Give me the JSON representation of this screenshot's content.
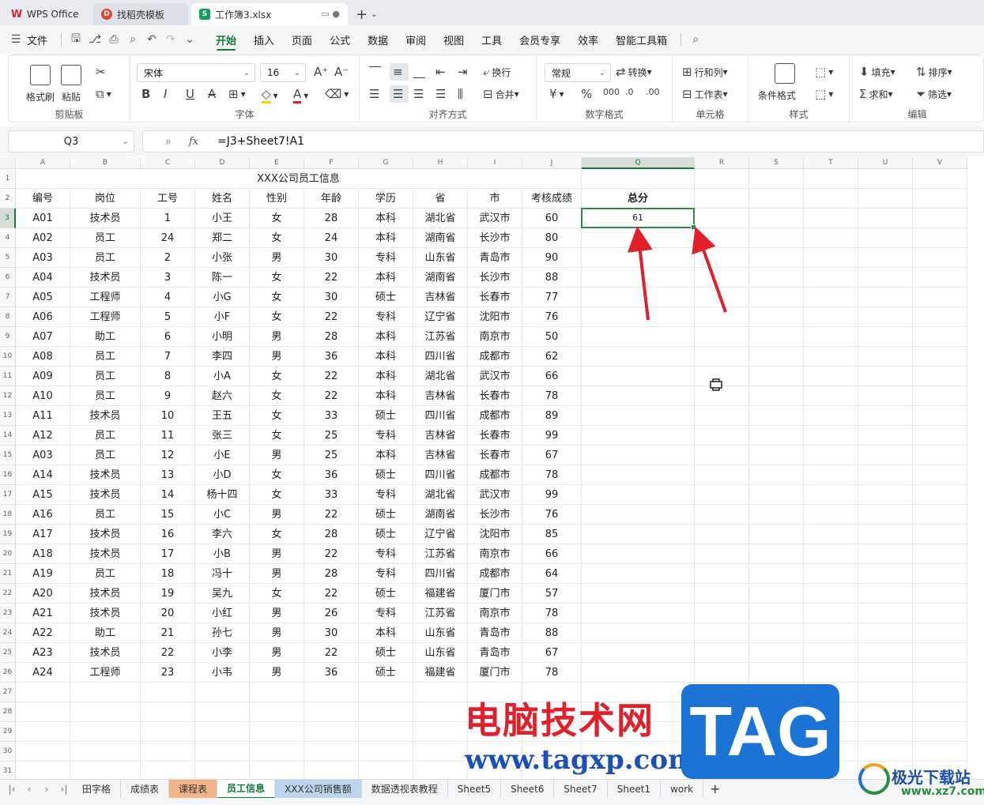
{
  "tabs": [
    {
      "label": "WPS Office",
      "icon": "wps-logo-icon"
    },
    {
      "label": "找稻壳模板",
      "icon": "docer-icon"
    },
    {
      "label": "工作簿3.xlsx",
      "icon": "sheet-icon"
    }
  ],
  "menu": {
    "file": "文件",
    "items": [
      "开始",
      "插入",
      "页面",
      "公式",
      "数据",
      "审阅",
      "视图",
      "工具",
      "会员专享",
      "效率",
      "智能工具箱"
    ],
    "active": "开始"
  },
  "ribbon": {
    "clipboard": {
      "label": "剪贴板",
      "format_painter": "格式刷",
      "paste": "粘贴"
    },
    "font": {
      "label": "字体",
      "name": "宋体",
      "size": "16"
    },
    "align": {
      "label": "对齐方式",
      "wrap": "换行",
      "merge": "合并"
    },
    "number": {
      "label": "数字格式",
      "format": "常规",
      "convert": "转换"
    },
    "cells": {
      "label": "单元格",
      "rowcol": "行和列",
      "worksheet": "工作表"
    },
    "styles": {
      "label": "样式",
      "conditional": "条件格式"
    },
    "editing": {
      "label": "编辑",
      "fill": "填充",
      "sort": "排序",
      "sum": "求和",
      "filter": "筛选"
    }
  },
  "formula_bar": {
    "name_box": "Q3",
    "fx": "fx",
    "formula": "=J3+Sheet7!A1"
  },
  "columns": [
    "A",
    "B",
    "C",
    "D",
    "E",
    "F",
    "G",
    "H",
    "I",
    "J",
    "Q",
    "R",
    "S",
    "T",
    "U",
    "V"
  ],
  "selected_column": "Q",
  "selected_row": "3",
  "sheet_title": "XXX公司员工信息",
  "headers": [
    "编号",
    "岗位",
    "工号",
    "姓名",
    "性别",
    "年龄",
    "学历",
    "省",
    "市",
    "考核成绩"
  ],
  "total_header": "总分",
  "total_value": "61",
  "rows": [
    [
      "A01",
      "技术员",
      "1",
      "小王",
      "女",
      "28",
      "本科",
      "湖北省",
      "武汉市",
      "60"
    ],
    [
      "A02",
      "员工",
      "24",
      "郑二",
      "女",
      "24",
      "本科",
      "湖南省",
      "长沙市",
      "80"
    ],
    [
      "A03",
      "员工",
      "2",
      "小张",
      "男",
      "30",
      "专科",
      "山东省",
      "青岛市",
      "90"
    ],
    [
      "A04",
      "技术员",
      "3",
      "陈一",
      "女",
      "22",
      "本科",
      "湖南省",
      "长沙市",
      "88"
    ],
    [
      "A05",
      "工程师",
      "4",
      "小G",
      "女",
      "30",
      "硕士",
      "吉林省",
      "长春市",
      "77"
    ],
    [
      "A06",
      "工程师",
      "5",
      "小F",
      "女",
      "22",
      "专科",
      "辽宁省",
      "沈阳市",
      "76"
    ],
    [
      "A07",
      "助工",
      "6",
      "小明",
      "男",
      "28",
      "本科",
      "江苏省",
      "南京市",
      "50"
    ],
    [
      "A08",
      "员工",
      "7",
      "李四",
      "男",
      "36",
      "本科",
      "四川省",
      "成都市",
      "62"
    ],
    [
      "A09",
      "员工",
      "8",
      "小A",
      "女",
      "22",
      "本科",
      "湖北省",
      "武汉市",
      "66"
    ],
    [
      "A10",
      "员工",
      "9",
      "赵六",
      "女",
      "22",
      "本科",
      "吉林省",
      "长春市",
      "78"
    ],
    [
      "A11",
      "技术员",
      "10",
      "王五",
      "女",
      "33",
      "硕士",
      "四川省",
      "成都市",
      "89"
    ],
    [
      "A12",
      "员工",
      "11",
      "张三",
      "女",
      "25",
      "专科",
      "吉林省",
      "长春市",
      "99"
    ],
    [
      "A03",
      "员工",
      "12",
      "小E",
      "男",
      "25",
      "本科",
      "吉林省",
      "长春市",
      "67"
    ],
    [
      "A14",
      "技术员",
      "13",
      "小D",
      "女",
      "36",
      "硕士",
      "四川省",
      "成都市",
      "78"
    ],
    [
      "A15",
      "技术员",
      "14",
      "杨十四",
      "女",
      "33",
      "专科",
      "湖北省",
      "武汉市",
      "99"
    ],
    [
      "A16",
      "员工",
      "15",
      "小C",
      "男",
      "22",
      "硕士",
      "湖南省",
      "长沙市",
      "76"
    ],
    [
      "A17",
      "技术员",
      "16",
      "李六",
      "女",
      "28",
      "硕士",
      "辽宁省",
      "沈阳市",
      "85"
    ],
    [
      "A18",
      "技术员",
      "17",
      "小B",
      "男",
      "22",
      "专科",
      "江苏省",
      "南京市",
      "66"
    ],
    [
      "A19",
      "员工",
      "18",
      "冯十",
      "男",
      "28",
      "专科",
      "四川省",
      "成都市",
      "64"
    ],
    [
      "A20",
      "技术员",
      "19",
      "吴九",
      "女",
      "22",
      "硕士",
      "福建省",
      "厦门市",
      "57"
    ],
    [
      "A21",
      "技术员",
      "20",
      "小红",
      "男",
      "26",
      "专科",
      "江苏省",
      "南京市",
      "78"
    ],
    [
      "A22",
      "助工",
      "21",
      "孙七",
      "男",
      "30",
      "本科",
      "山东省",
      "青岛市",
      "88"
    ],
    [
      "A23",
      "技术员",
      "22",
      "小李",
      "男",
      "22",
      "硕士",
      "山东省",
      "青岛市",
      "67"
    ],
    [
      "A24",
      "工程师",
      "23",
      "小韦",
      "男",
      "36",
      "硕士",
      "福建省",
      "厦门市",
      "78"
    ]
  ],
  "sheets": [
    {
      "label": "田字格",
      "style": ""
    },
    {
      "label": "成绩表",
      "style": ""
    },
    {
      "label": "课程表",
      "style": "orange"
    },
    {
      "label": "员工信息",
      "style": "active"
    },
    {
      "label": "XXX公司销售额",
      "style": "blue"
    },
    {
      "label": "数据透视表教程",
      "style": ""
    },
    {
      "label": "Sheet5",
      "style": ""
    },
    {
      "label": "Sheet6",
      "style": ""
    },
    {
      "label": "Sheet7",
      "style": ""
    },
    {
      "label": "Sheet1",
      "style": ""
    },
    {
      "label": "work",
      "style": ""
    }
  ],
  "watermark": {
    "cn": "电脑技术网",
    "url": "www.tagxp.com",
    "tag": "TAG",
    "jg": "极光下载站",
    "jg_url": "www.xz7.com"
  },
  "colors": {
    "accent": "#127b3c",
    "selection": "#2f8b48",
    "arrow": "#e0202a"
  }
}
